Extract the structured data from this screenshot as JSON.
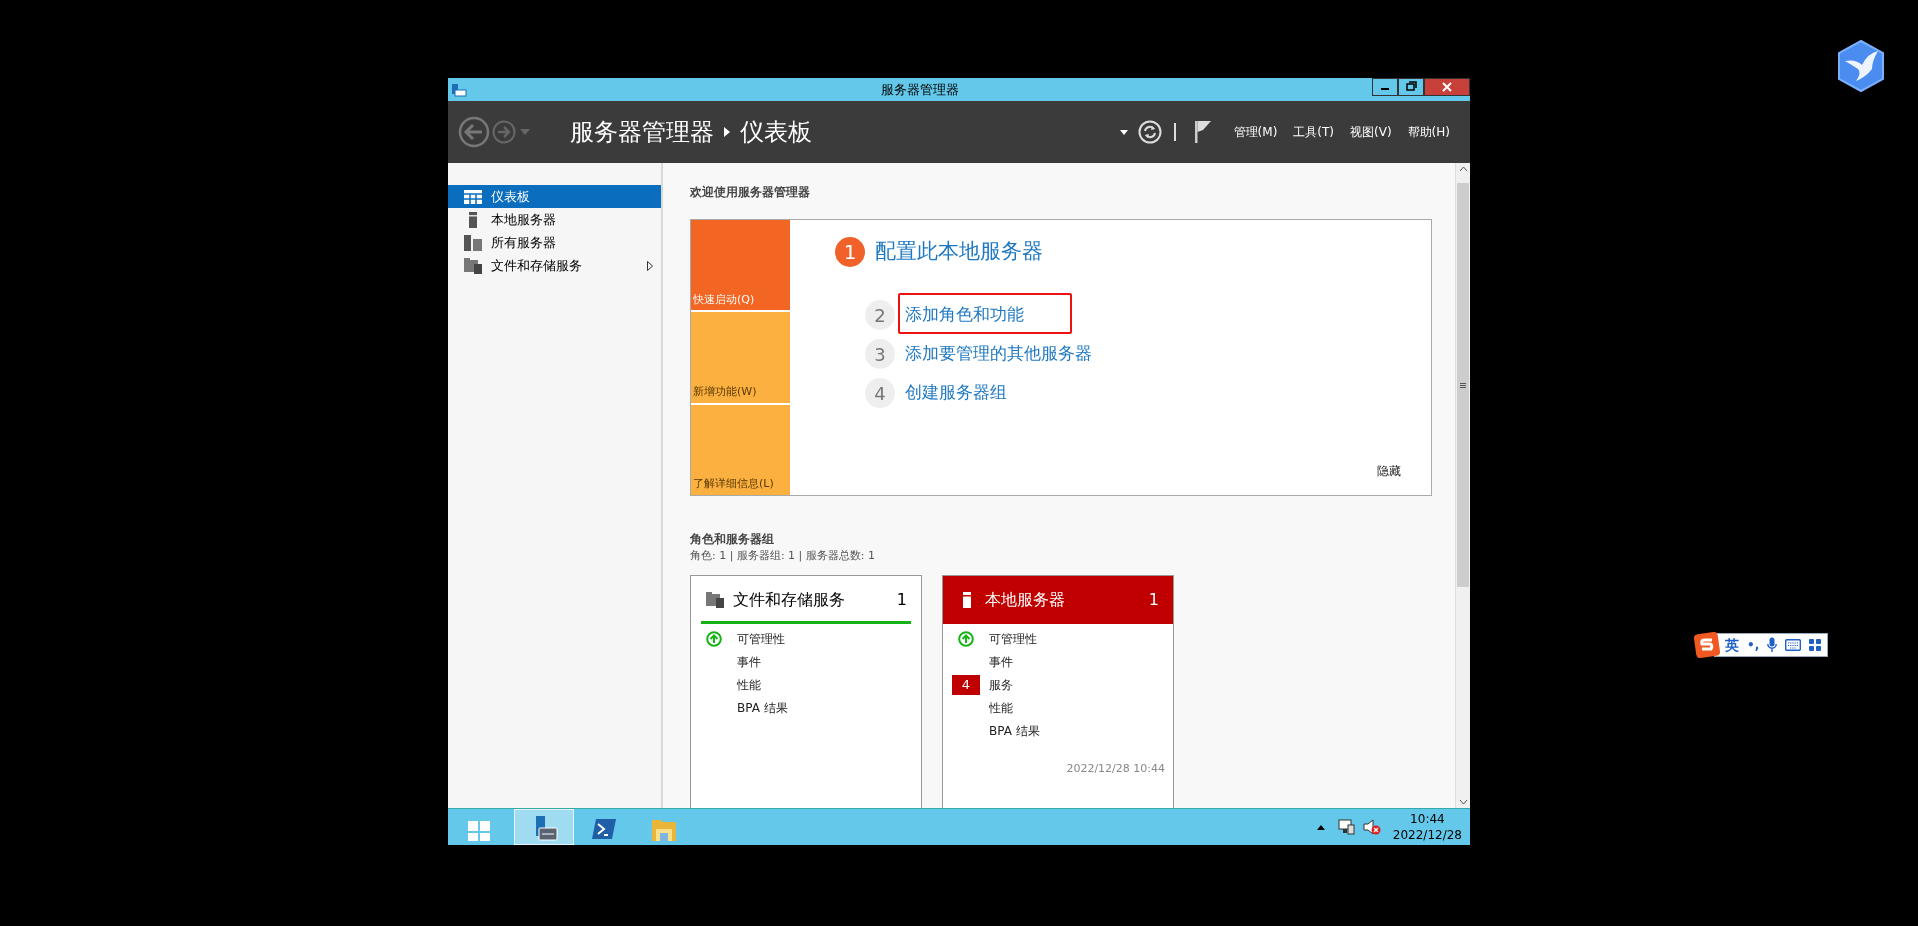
{
  "window": {
    "title": "服务器管理器"
  },
  "header": {
    "breadcrumb": [
      "服务器管理器",
      "仪表板"
    ],
    "menus": [
      "管理(M)",
      "工具(T)",
      "视图(V)",
      "帮助(H)"
    ]
  },
  "sidebar": {
    "items": [
      {
        "label": "仪表板",
        "kind": "dashboard",
        "selected": true,
        "expandable": false
      },
      {
        "label": "本地服务器",
        "kind": "server",
        "selected": false,
        "expandable": false
      },
      {
        "label": "所有服务器",
        "kind": "servers",
        "selected": false,
        "expandable": false
      },
      {
        "label": "文件和存储服务",
        "kind": "storage",
        "selected": false,
        "expandable": true
      }
    ]
  },
  "welcome": {
    "title": "欢迎使用服务器管理器",
    "tiles": [
      {
        "label": "快速启动(Q)",
        "kind": "primary"
      },
      {
        "label": "新增功能(W)",
        "kind": "secondary"
      },
      {
        "label": "了解详细信息(L)",
        "kind": "secondary"
      }
    ],
    "steps": [
      {
        "number": "1",
        "label": "配置此本地服务器",
        "kind": "main",
        "highlighted": false
      },
      {
        "number": "2",
        "label": "添加角色和功能",
        "kind": "sub",
        "highlighted": true
      },
      {
        "number": "3",
        "label": "添加要管理的其他服务器",
        "kind": "sub",
        "highlighted": false
      },
      {
        "number": "4",
        "label": "创建服务器组",
        "kind": "sub",
        "highlighted": false
      }
    ],
    "hide_link": "隐藏"
  },
  "roles": {
    "title": "角色和服务器组",
    "summary": "角色: 1 | 服务器组: 1 | 服务器总数: 1",
    "cards": [
      {
        "title": "文件和存储服务",
        "count": "1",
        "kind": "ok",
        "items": [
          {
            "label": "可管理性",
            "kind": "ok"
          },
          {
            "label": "事件"
          },
          {
            "label": "性能"
          },
          {
            "label": "BPA 结果"
          }
        ]
      },
      {
        "title": "本地服务器",
        "count": "1",
        "kind": "alert",
        "items": [
          {
            "label": "可管理性",
            "kind": "ok"
          },
          {
            "label": "事件"
          },
          {
            "label": "服务",
            "badge": "4"
          },
          {
            "label": "性能"
          },
          {
            "label": "BPA 结果"
          }
        ],
        "timestamp": "2022/12/28 10:44"
      }
    ]
  },
  "taskbar": {
    "items": [
      {
        "kind": "start",
        "selected": false
      },
      {
        "kind": "server-manager",
        "selected": true
      },
      {
        "kind": "powershell",
        "selected": false
      },
      {
        "kind": "explorer",
        "selected": false
      }
    ],
    "time": "10:44",
    "date": "2022/12/28"
  },
  "ime": {
    "mode": "英",
    "punctuation": "•,"
  }
}
